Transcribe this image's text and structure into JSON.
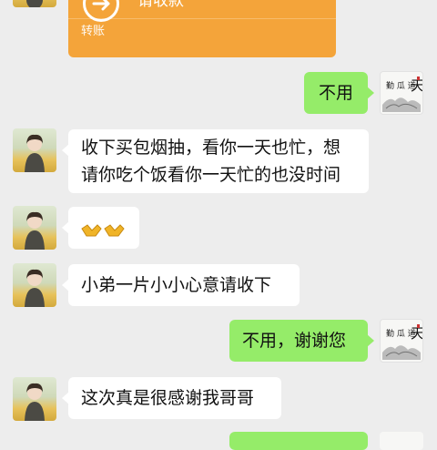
{
  "transfer": {
    "title": "请收款",
    "label": "转账",
    "color": "#f4a43a",
    "icon": "arrow-right-icon"
  },
  "messages": [
    {
      "side": "right",
      "text": "不用"
    },
    {
      "side": "left",
      "lines": [
        "收下买包烟抽，看你一天也忙，想",
        "请你吃个饭看你一天忙的也没时间"
      ]
    },
    {
      "side": "left",
      "emoji": "gold-ingot-icon"
    },
    {
      "side": "left",
      "text": "小弟一片小小心意请收下"
    },
    {
      "side": "right",
      "text": "不用，谢谢您"
    },
    {
      "side": "left",
      "text": "这次真是很感谢我哥哥"
    }
  ],
  "colors": {
    "background": "#ededed",
    "self_bubble": "#95ec69",
    "other_bubble": "#ffffff"
  }
}
